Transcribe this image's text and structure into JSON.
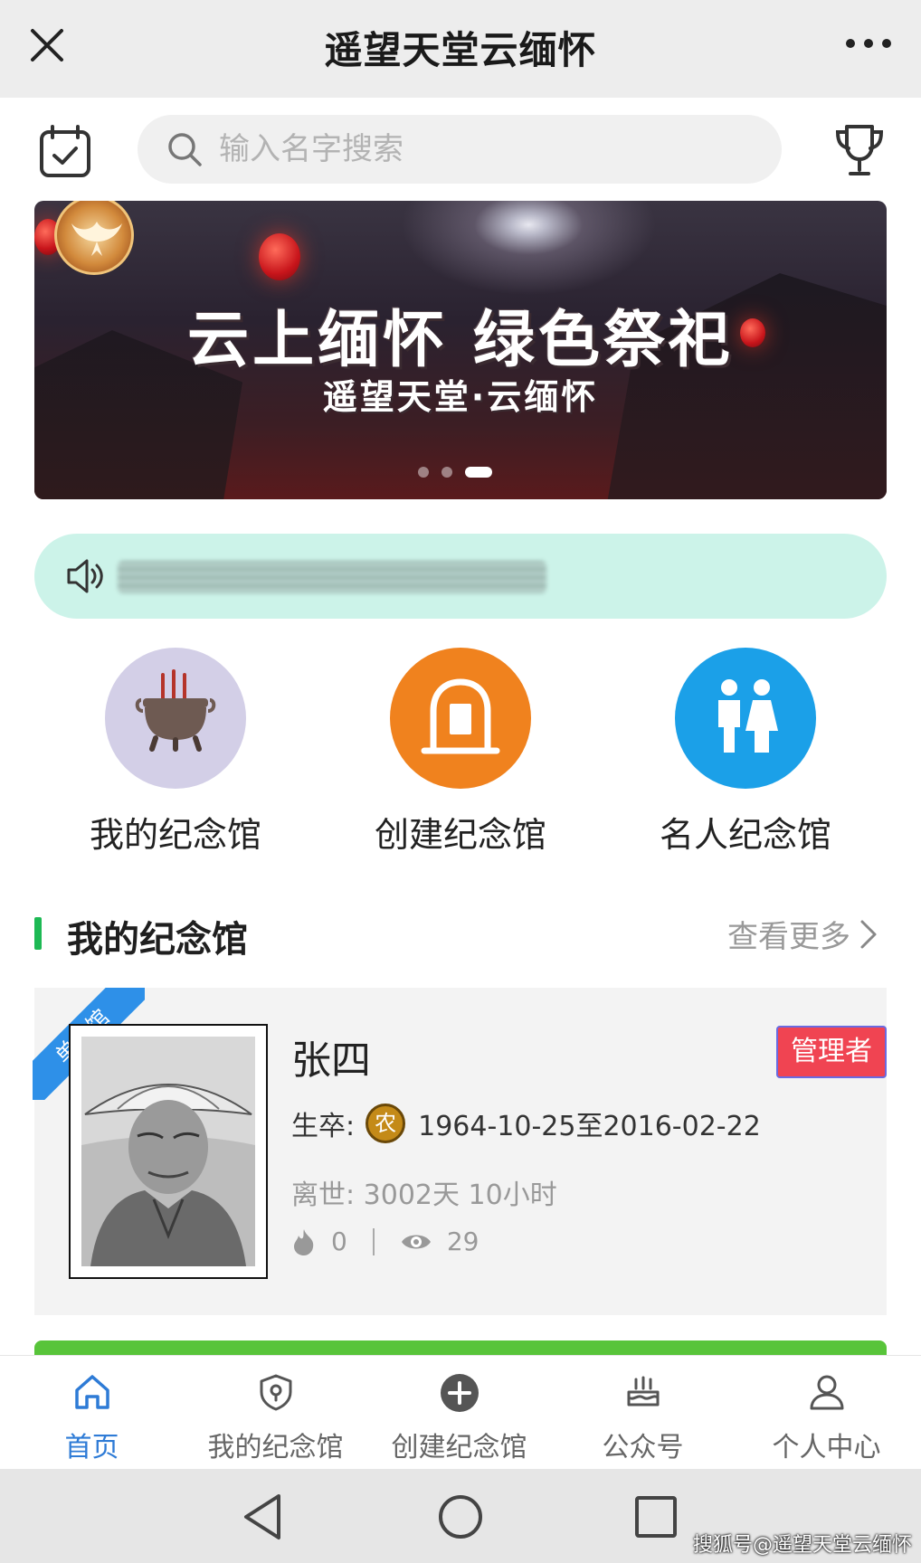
{
  "header": {
    "title": "遥望天堂云缅怀",
    "close_icon": "close-icon",
    "more_icon": "more-dots-icon"
  },
  "search": {
    "placeholder": "输入名字搜索",
    "left_icon": "calendar-check-icon",
    "right_icon": "trophy-icon"
  },
  "banner": {
    "headline": "云上缅怀 绿色祭祀",
    "subline": "遥望天堂·云缅怀",
    "slide_count": 3,
    "active_slide": 3
  },
  "notice": {
    "icon": "speaker-icon",
    "text": ""
  },
  "actions": [
    {
      "label": "我的纪念馆",
      "icon": "incense-burner-icon",
      "color": "#d3cfe7"
    },
    {
      "label": "创建纪念馆",
      "icon": "tombstone-icon",
      "color": "#f0821e"
    },
    {
      "label": "名人纪念馆",
      "icon": "people-icon",
      "color": "#1ba0e8"
    }
  ],
  "section": {
    "title": "我的纪念馆",
    "more_label": "查看更多"
  },
  "memorial": {
    "ribbon": "单人馆",
    "name": "张四",
    "role_badge": "管理者",
    "dates_label": "生卒:",
    "zodiac": "农",
    "dates": "1964-10-25至2016-02-22",
    "passed": "离世: 3002天 10小时",
    "flames": "0",
    "views": "29"
  },
  "tabbar": [
    {
      "label": "首页",
      "icon": "home-icon",
      "active": true
    },
    {
      "label": "我的纪念馆",
      "icon": "shield-location-icon",
      "active": false
    },
    {
      "label": "创建纪念馆",
      "icon": "plus-circle-icon",
      "active": false
    },
    {
      "label": "公众号",
      "icon": "cake-icon",
      "active": false
    },
    {
      "label": "个人中心",
      "icon": "user-icon",
      "active": false
    }
  ],
  "colors": {
    "accent_blue": "#2e7bd6",
    "section_green": "#1db954",
    "notice_bg": "#ccf3e9",
    "badge_red": "#f04452"
  },
  "watermark": "搜狐号@遥望天堂云缅怀"
}
